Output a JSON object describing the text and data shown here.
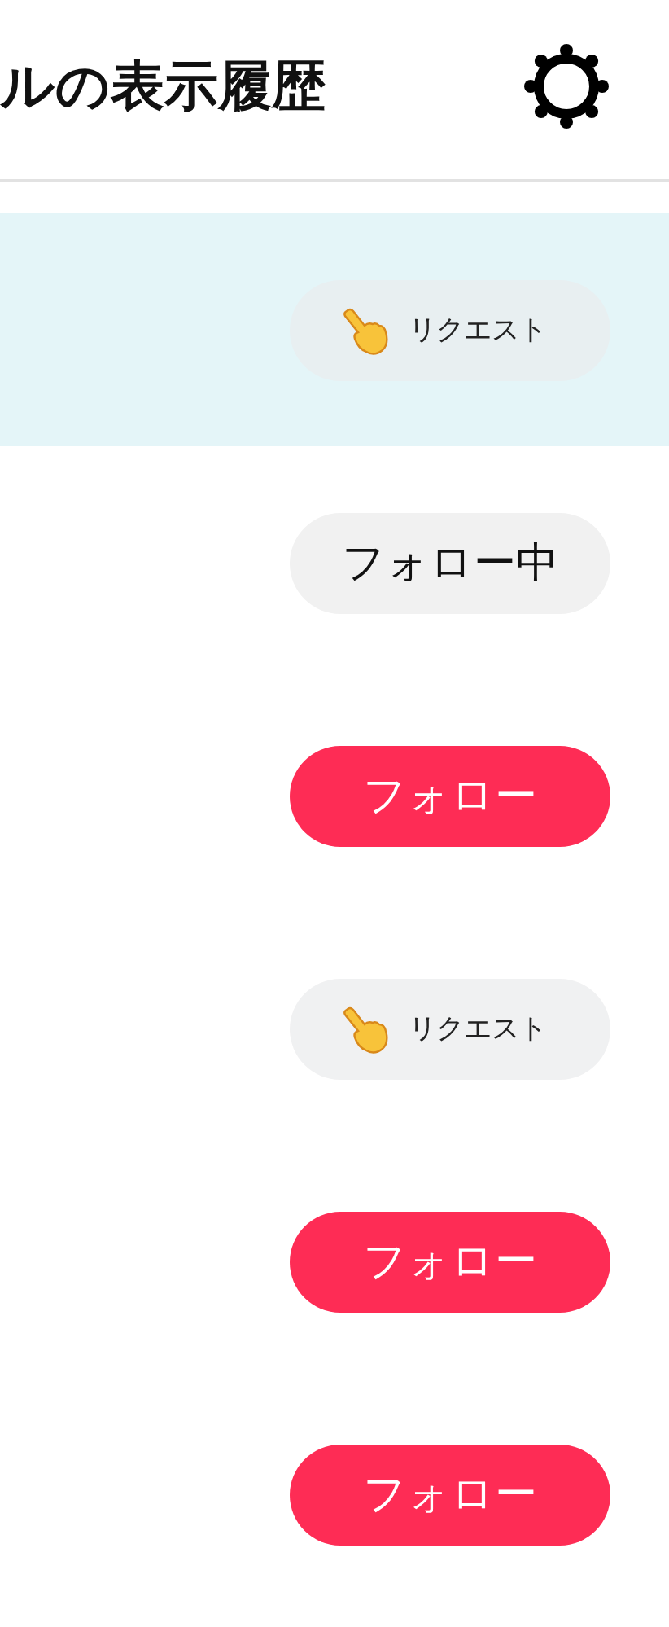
{
  "header": {
    "title": "ルの表示履歴"
  },
  "rows": [
    {
      "kind": "request",
      "label": "リクエスト",
      "highlighted": true
    },
    {
      "kind": "following",
      "label": "フォロー中",
      "highlighted": false
    },
    {
      "kind": "follow",
      "label": "フォロー",
      "highlighted": false
    },
    {
      "kind": "request",
      "label": "リクエスト",
      "highlighted": false
    },
    {
      "kind": "follow",
      "label": "フォロー",
      "highlighted": false
    },
    {
      "kind": "follow",
      "label": "フォロー",
      "highlighted": false
    }
  ]
}
